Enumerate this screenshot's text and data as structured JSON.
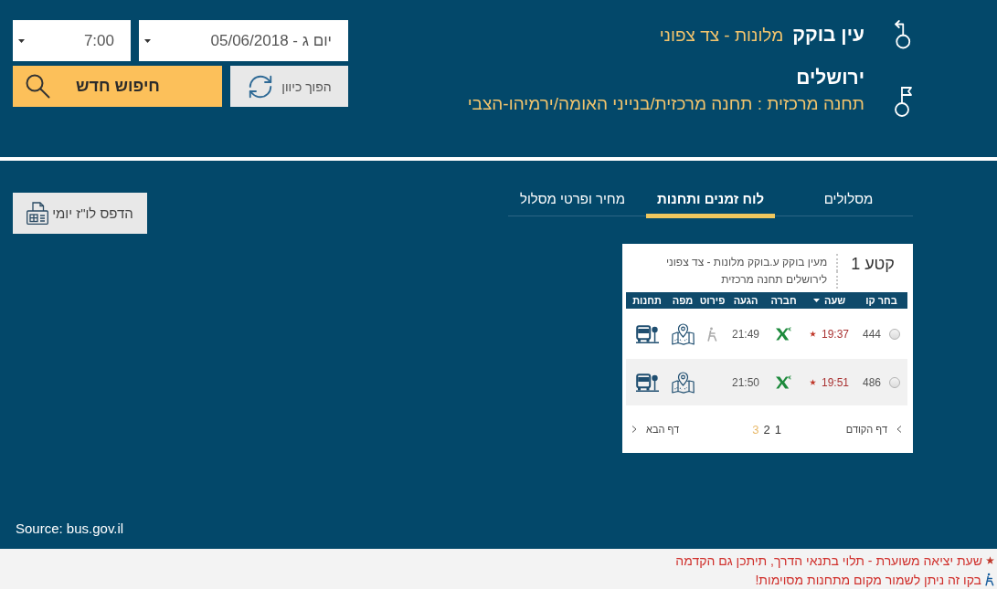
{
  "trip": {
    "origin": {
      "city": "עין בוקק",
      "stop": "מלונות - צד צפוני"
    },
    "destination": {
      "city": "ירושלים",
      "stop": "תחנה מרכזית : תחנה מרכזית/בנייני האומה/ירמיהו-הצבי"
    }
  },
  "search_form": {
    "time": "7:00",
    "date": "יום ג - 05/06/2018",
    "search_button": "חיפוש חדש",
    "reverse_button": "הפוך כיוון"
  },
  "tabs": [
    {
      "label": "מסלולים",
      "selected": false
    },
    {
      "label": "לוח זמנים ותחנות",
      "selected": true
    },
    {
      "label": "מחיר ופרטי מסלול",
      "selected": false
    }
  ],
  "print_button": "הדפס לו\"ז יומי",
  "segment": {
    "title": "קטע 1",
    "from": "מעין בוקק ע.בוקק מלונות - צד צפוני",
    "to": "לירושלים תחנה מרכזית",
    "columns": [
      {
        "label": "בחר קו",
        "sorted": false
      },
      {
        "label": "שעה",
        "sorted": true
      },
      {
        "label": "חברה",
        "sorted": false
      },
      {
        "label": "הגעה",
        "sorted": false
      },
      {
        "label": "פירוט",
        "sorted": false
      },
      {
        "label": "מפה",
        "sorted": false
      },
      {
        "label": "תחנות",
        "sorted": false
      }
    ],
    "rows": [
      {
        "selected": false,
        "line": "444",
        "departure": "19:37",
        "estimated": true,
        "arrival": "21:49",
        "reservable": true
      },
      {
        "selected": false,
        "line": "486",
        "departure": "19:51",
        "estimated": true,
        "arrival": "21:50",
        "reservable": false
      }
    ],
    "pagination": {
      "previous": "דף הקודם",
      "pages": [
        {
          "label": "1",
          "selected": false
        },
        {
          "label": "2",
          "selected": false
        },
        {
          "label": "3",
          "selected": true
        }
      ],
      "next": "דף הבא"
    }
  },
  "source": "Source: bus.gov.il",
  "footnotes": [
    {
      "kind": "estimated",
      "text": "שעת יציאה משוערת - תלוי בתנאי הדרך, תיתכן גם הקדמה"
    },
    {
      "kind": "reservable",
      "text": "בקו זה ניתן לשמור מקום מתחנות מסוימות!"
    }
  ]
}
